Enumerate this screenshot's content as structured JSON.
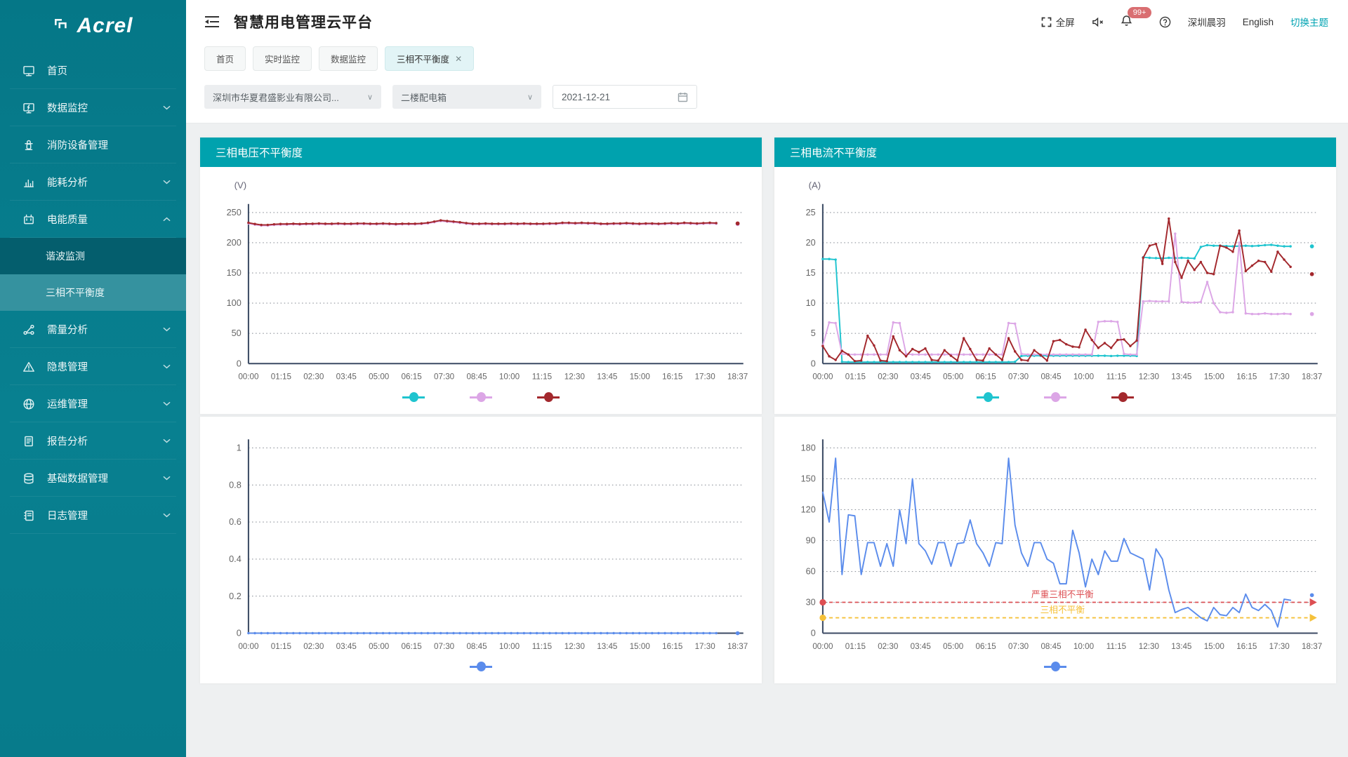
{
  "brand": {
    "name": "Acrel"
  },
  "header": {
    "title": "智慧用电管理云平台",
    "fullscreen_label": "全屏",
    "notification_count": "99+",
    "username": "深圳晨羽",
    "language_label": "English",
    "theme_switch_label": "切换主题"
  },
  "tabs": [
    {
      "label": "首页",
      "active": false,
      "closable": false
    },
    {
      "label": "实时监控",
      "active": false,
      "closable": false
    },
    {
      "label": "数据监控",
      "active": false,
      "closable": false
    },
    {
      "label": "三相不平衡度",
      "active": true,
      "closable": true
    }
  ],
  "sidebar": {
    "items": [
      {
        "id": "home",
        "label": "首页",
        "icon": "monitor-icon",
        "expandable": false
      },
      {
        "id": "data-monitor",
        "label": "数据监控",
        "icon": "data-screen-icon",
        "expandable": true
      },
      {
        "id": "fire-equipment",
        "label": "消防设备管理",
        "icon": "fire-hydrant-icon",
        "expandable": false
      },
      {
        "id": "energy-analysis",
        "label": "能耗分析",
        "icon": "bar-chart-icon",
        "expandable": true
      },
      {
        "id": "power-quality",
        "label": "电能质量",
        "icon": "power-meter-icon",
        "expandable": true,
        "expanded": true,
        "children": [
          {
            "id": "harmonic-monitor",
            "label": "谐波监测",
            "active": false
          },
          {
            "id": "three-phase-unbalance",
            "label": "三相不平衡度",
            "active": true
          }
        ]
      },
      {
        "id": "demand-analysis",
        "label": "需量分析",
        "icon": "share-nodes-icon",
        "expandable": true
      },
      {
        "id": "hazard-management",
        "label": "隐患管理",
        "icon": "warning-triangle-icon",
        "expandable": true
      },
      {
        "id": "ops-management",
        "label": "运维管理",
        "icon": "globe-icon",
        "expandable": true
      },
      {
        "id": "report-analysis",
        "label": "报告分析",
        "icon": "report-icon",
        "expandable": true
      },
      {
        "id": "base-data",
        "label": "基础数据管理",
        "icon": "database-icon",
        "expandable": true
      },
      {
        "id": "log-management",
        "label": "日志管理",
        "icon": "logbook-icon",
        "expandable": true
      }
    ]
  },
  "filters": {
    "station": "深圳市华夏君盛影业有限公司...",
    "distribution_box": "二楼配电箱",
    "date": "2021-12-21"
  },
  "chart_data": [
    {
      "type": "line",
      "title": "三相电压不平衡度",
      "unit": "(V)",
      "ylim": [
        0,
        250
      ],
      "yticks": [
        0,
        50,
        100,
        150,
        200,
        250
      ],
      "x_ticks": [
        "00:00",
        "01:15",
        "02:30",
        "03:45",
        "05:00",
        "06:15",
        "07:30",
        "08:45",
        "10:00",
        "11:15",
        "12:30",
        "13:45",
        "15:00",
        "16:15",
        "17:30",
        "18:37"
      ],
      "grid": "dotted",
      "legend_position": "bottom",
      "series": [
        {
          "name": "phase-a",
          "color": "#1fc4cf",
          "dots": true,
          "detached_last": 231.4,
          "values": [
            232.4,
            230.4,
            229,
            229,
            230,
            230.4,
            230.4,
            231,
            230.4,
            231,
            231,
            231.4,
            231,
            231,
            231.4,
            231,
            231,
            231.4,
            231.4,
            231,
            231,
            231.4,
            231,
            230.4,
            231,
            231,
            231,
            231.6,
            232.6,
            234.6,
            236.4,
            235.4,
            234.4,
            233.4,
            232,
            231,
            231,
            231.4,
            231,
            231,
            231,
            231.4,
            231,
            231.4,
            231,
            231,
            231,
            231.4,
            231.4,
            232.4,
            232.4,
            232,
            232.4,
            232,
            232,
            231,
            231,
            231.4,
            231.4,
            232,
            231.4,
            231,
            231.4,
            231.4,
            231,
            231.4,
            232,
            231.4,
            232.4,
            232,
            231.4,
            232,
            232.4,
            232
          ]
        },
        {
          "name": "phase-b",
          "color": "#dca6e6",
          "dots": true,
          "detached_last": 230.8,
          "values": [
            231.8,
            229.8,
            228.4,
            228.4,
            229.4,
            229.8,
            229.8,
            230.4,
            229.8,
            230.4,
            230.4,
            230.8,
            230.4,
            230.4,
            230.8,
            230.4,
            230.4,
            230.8,
            230.8,
            230.4,
            230.4,
            230.8,
            230.4,
            229.8,
            230.4,
            230.4,
            230.4,
            231,
            232,
            234,
            235.8,
            234.8,
            233.8,
            232.8,
            231.4,
            230.4,
            230.4,
            230.8,
            230.4,
            230.4,
            230.4,
            230.8,
            230.4,
            230.8,
            230.4,
            230.4,
            230.4,
            230.8,
            230.8,
            231.8,
            231.8,
            231.4,
            231.8,
            231.4,
            231.4,
            230.4,
            230.4,
            230.8,
            230.8,
            231.4,
            230.8,
            230.4,
            230.8,
            230.8,
            230.4,
            230.8,
            231.4,
            230.8,
            231.8,
            231.4,
            230.8,
            231.4,
            231.8,
            231.4
          ]
        },
        {
          "name": "phase-c",
          "color": "#a3282d",
          "dots": true,
          "detached_last": 232,
          "values": [
            233,
            231,
            229.5,
            229.5,
            230.5,
            231,
            231,
            231.5,
            231,
            231.5,
            231.5,
            232,
            231.5,
            231.5,
            232,
            231.5,
            231.5,
            232,
            232,
            231.5,
            231.5,
            232,
            231.5,
            231,
            231.5,
            231.5,
            231.5,
            232,
            233,
            235,
            237,
            236,
            235,
            234,
            232.5,
            231.5,
            231.5,
            232,
            231.5,
            231.5,
            231.5,
            232,
            231.5,
            232,
            231.5,
            231.5,
            231.5,
            232,
            232,
            233,
            233,
            232.5,
            233,
            232.5,
            232.5,
            231.5,
            231.5,
            232,
            232,
            232.5,
            232,
            231.5,
            232,
            232,
            231.5,
            232,
            232.5,
            232,
            233,
            232.5,
            232,
            232.5,
            233,
            232.5
          ]
        }
      ]
    },
    {
      "type": "line",
      "title": "三相电流不平衡度",
      "unit": "(A)",
      "ylim": [
        0,
        25
      ],
      "yticks": [
        0,
        5,
        10,
        15,
        20,
        25
      ],
      "x_ticks": [
        "00:00",
        "01:15",
        "02:30",
        "03:45",
        "05:00",
        "06:15",
        "07:30",
        "08:45",
        "10:00",
        "11:15",
        "12:30",
        "13:45",
        "15:00",
        "16:15",
        "17:30",
        "18:37"
      ],
      "grid": "dotted",
      "legend_position": "bottom",
      "series": [
        {
          "name": "phase-a",
          "color": "#1fc4cf",
          "dots": true,
          "detached_last": 19.4,
          "values": [
            17.3,
            17.3,
            17.2,
            0.3,
            0.25,
            0.25,
            0.25,
            0.25,
            0.25,
            0.25,
            0.25,
            0.25,
            0.25,
            0.25,
            0.25,
            0.25,
            0.25,
            0.25,
            0.25,
            0.25,
            0.25,
            0.25,
            0.25,
            0.25,
            0.25,
            0.25,
            0.25,
            0.25,
            0.25,
            0.25,
            0.3,
            1.25,
            1.3,
            1.3,
            1.3,
            1.3,
            1.3,
            1.3,
            1.3,
            1.3,
            1.3,
            1.3,
            1.3,
            1.3,
            1.3,
            1.25,
            1.3,
            1.3,
            1.3,
            1.25,
            17.6,
            17.5,
            17.45,
            17.4,
            17.5,
            17.45,
            17.5,
            17.45,
            17.4,
            19.3,
            19.6,
            19.5,
            19.5,
            19.45,
            19.4,
            19.45,
            19.5,
            19.45,
            19.5,
            19.6,
            19.65,
            19.5,
            19.4,
            19.4
          ]
        },
        {
          "name": "phase-b",
          "color": "#dca6e6",
          "dots": true,
          "detached_last": 8.2,
          "values": [
            3.0,
            6.8,
            6.7,
            1.6,
            1.5,
            1.5,
            1.5,
            1.5,
            1.5,
            1.5,
            1.5,
            6.8,
            6.7,
            1.6,
            1.5,
            1.5,
            1.5,
            1.5,
            1.5,
            1.5,
            1.5,
            1.5,
            1.5,
            1.5,
            1.5,
            1.5,
            1.5,
            1.5,
            1.5,
            6.7,
            6.6,
            1.6,
            1.5,
            1.5,
            1.5,
            1.5,
            1.5,
            1.5,
            1.5,
            1.5,
            1.5,
            1.5,
            1.5,
            6.9,
            7.0,
            7.0,
            6.9,
            1.6,
            1.5,
            1.5,
            10.3,
            10.35,
            10.3,
            10.3,
            10.3,
            21.5,
            10.2,
            10.1,
            10.1,
            10.2,
            13.5,
            10.0,
            8.5,
            8.4,
            8.5,
            20.0,
            8.3,
            8.2,
            8.2,
            8.3,
            8.2,
            8.2,
            8.25,
            8.2
          ]
        },
        {
          "name": "phase-c",
          "color": "#a3282d",
          "dots": true,
          "detached_last": 14.8,
          "values": [
            2.9,
            1.2,
            0.6,
            2.1,
            1.5,
            0.4,
            0.5,
            4.6,
            3.0,
            0.5,
            0.4,
            4.5,
            2.2,
            1.2,
            2.4,
            1.9,
            2.5,
            0.6,
            0.5,
            2.2,
            1.3,
            0.5,
            4.2,
            2.4,
            0.6,
            0.5,
            2.5,
            1.5,
            0.6,
            4.2,
            2.0,
            0.6,
            0.5,
            2.2,
            1.4,
            0.5,
            3.7,
            3.9,
            3.2,
            2.8,
            2.7,
            5.6,
            3.9,
            2.6,
            3.4,
            2.6,
            3.9,
            4.0,
            2.9,
            3.8,
            17.5,
            19.5,
            19.8,
            16.5,
            24.0,
            16.8,
            14.2,
            17.0,
            15.5,
            16.8,
            15.0,
            14.8,
            19.5,
            19.2,
            18.5,
            22.0,
            15.3,
            16.2,
            17.0,
            16.8,
            15.2,
            18.5,
            17.2,
            16.0
          ]
        }
      ]
    },
    {
      "type": "line",
      "title": "",
      "unit": "",
      "ylim": [
        0,
        1
      ],
      "yticks": [
        0,
        0.2,
        0.4,
        0.6,
        0.8,
        1
      ],
      "x_ticks": [
        "00:00",
        "01:15",
        "02:30",
        "03:45",
        "05:00",
        "06:15",
        "07:30",
        "08:45",
        "10:00",
        "11:15",
        "12:30",
        "13:45",
        "15:00",
        "16:15",
        "17:30",
        "18:37"
      ],
      "grid": "dotted",
      "legend_position": "bottom",
      "series": [
        {
          "name": "voltage-unbalance-degree",
          "color": "#5b8cec",
          "dots": true,
          "detached_last": 0,
          "values": [
            0,
            0,
            0,
            0,
            0,
            0,
            0,
            0,
            0,
            0,
            0,
            0,
            0,
            0,
            0,
            0,
            0,
            0,
            0,
            0,
            0,
            0,
            0,
            0,
            0,
            0,
            0,
            0,
            0,
            0,
            0,
            0,
            0,
            0,
            0,
            0,
            0,
            0,
            0,
            0,
            0,
            0,
            0,
            0,
            0,
            0,
            0,
            0,
            0,
            0,
            0,
            0,
            0,
            0,
            0,
            0,
            0,
            0,
            0,
            0,
            0,
            0,
            0,
            0,
            0,
            0,
            0,
            0,
            0,
            0,
            0,
            0,
            0,
            0
          ]
        }
      ]
    },
    {
      "type": "line",
      "title": "",
      "unit": "",
      "ylim": [
        0,
        180
      ],
      "yticks": [
        0,
        30,
        60,
        90,
        120,
        150,
        180
      ],
      "x_ticks": [
        "00:00",
        "01:15",
        "02:30",
        "03:45",
        "05:00",
        "06:15",
        "07:30",
        "08:45",
        "10:00",
        "11:15",
        "12:30",
        "13:45",
        "15:00",
        "16:15",
        "17:30",
        "18:37"
      ],
      "grid": "dotted",
      "legend_position": "bottom",
      "thresholds": [
        {
          "value": 30,
          "color": "#dd4f53",
          "label": "严重三相不平衡"
        },
        {
          "value": 15,
          "color": "#f5c13a",
          "label": "三相不平衡"
        }
      ],
      "series": [
        {
          "name": "current-unbalance-degree",
          "color": "#5b8cec",
          "dots": false,
          "detached_last": 37,
          "values": [
            137,
            108,
            170,
            57,
            115,
            114,
            57,
            88,
            88,
            65,
            87,
            65,
            120,
            87,
            150,
            87,
            80,
            67,
            88,
            88,
            65,
            87,
            88,
            110,
            87,
            78,
            65,
            88,
            87,
            170,
            105,
            78,
            65,
            88,
            88,
            72,
            68,
            48,
            48,
            100,
            78,
            45,
            72,
            57,
            80,
            70,
            70,
            92,
            78,
            75,
            72,
            42,
            82,
            72,
            42,
            20,
            23,
            25,
            20,
            15,
            12,
            25,
            18,
            17,
            25,
            20,
            38,
            25,
            22,
            28,
            22,
            6,
            33,
            32
          ]
        }
      ]
    }
  ]
}
